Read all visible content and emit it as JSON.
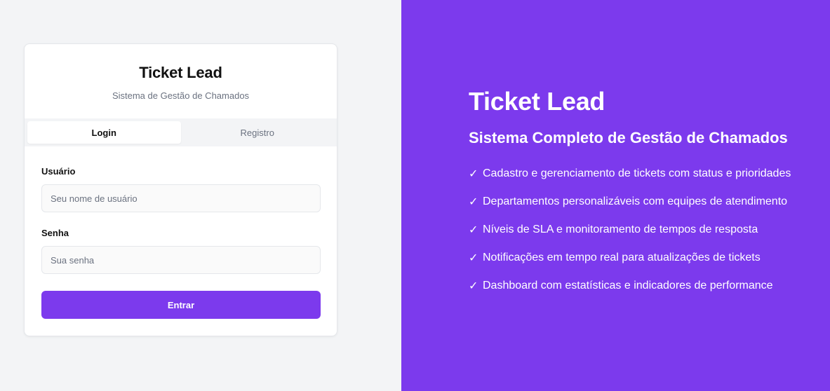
{
  "login_card": {
    "title": "Ticket Lead",
    "subtitle": "Sistema de Gestão de Chamados",
    "tabs": [
      {
        "label": "Login",
        "active": true
      },
      {
        "label": "Registro",
        "active": false
      }
    ],
    "form": {
      "username_label": "Usuário",
      "username_placeholder": "Seu nome de usuário",
      "username_value": "",
      "password_label": "Senha",
      "password_placeholder": "Sua senha",
      "password_value": "",
      "submit_label": "Entrar"
    }
  },
  "hero": {
    "title": "Ticket Lead",
    "subtitle": "Sistema Completo de Gestão de Chamados",
    "check_icon": "check-icon",
    "check_glyph": "✓",
    "features": [
      "Cadastro e gerenciamento de tickets com status e prioridades",
      "Departamentos personalizáveis com equipes de atendimento",
      "Níveis de SLA e monitoramento de tempos de resposta",
      "Notificações em tempo real para atualizações de tickets",
      "Dashboard com estatísticas e indicadores de performance"
    ]
  },
  "colors": {
    "accent": "#7c3aed",
    "left_background": "#f3f4f6",
    "card_background": "#ffffff"
  }
}
